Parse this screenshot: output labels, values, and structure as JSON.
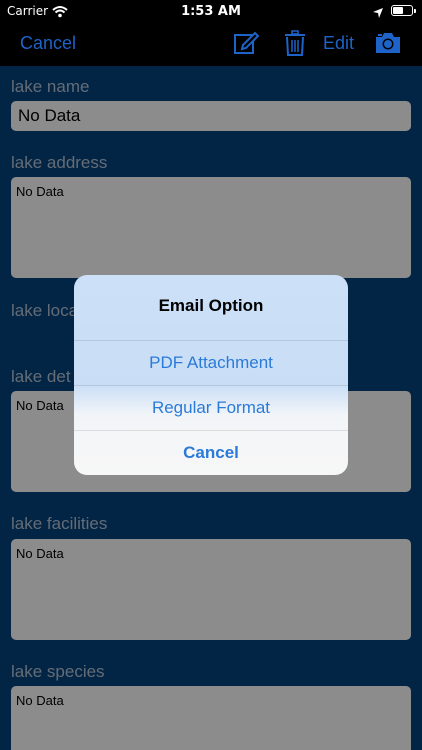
{
  "status_bar": {
    "carrier": "Carrier",
    "time": "1:53 AM"
  },
  "nav": {
    "cancel_label": "Cancel",
    "edit_label": "Edit",
    "icons": [
      "compose-icon",
      "trash-icon",
      "camera-icon"
    ],
    "accent_color": "#1e63c7"
  },
  "form": {
    "fields": [
      {
        "label": "lake name",
        "value": "No Data"
      },
      {
        "label": "lake address",
        "value": "No Data"
      },
      {
        "label": "lake loca"
      },
      {
        "label": "lake det",
        "value": "No Data"
      },
      {
        "label": "lake facilities",
        "value": "No Data"
      },
      {
        "label": "lake species",
        "value": "No Data"
      }
    ]
  },
  "alert": {
    "title": "Email Option",
    "actions": [
      {
        "label": "PDF Attachment"
      },
      {
        "label": "Regular Format"
      },
      {
        "label": "Cancel"
      }
    ],
    "action_color": "#2a7ad9"
  }
}
